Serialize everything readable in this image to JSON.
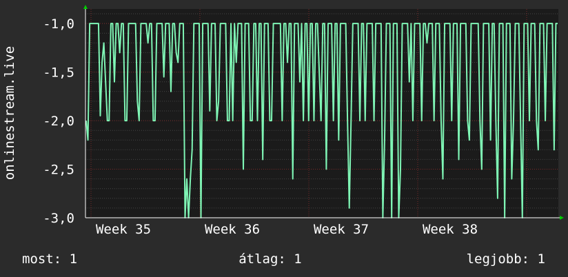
{
  "chart_data": {
    "type": "line",
    "ylabel": "onlinestream.live",
    "ylim": [
      -3.0,
      -0.85
    ],
    "y_ticks": [
      "-1,0",
      "-1,5",
      "-2,0",
      "-2,5",
      "-3,0"
    ],
    "y_tick_values": [
      -1.0,
      -1.5,
      -2.0,
      -2.5,
      -3.0
    ],
    "x_week_labels": [
      "Week 35",
      "Week 36",
      "Week 37",
      "Week 38"
    ],
    "grid": true,
    "series": [
      {
        "color": "#7ff5b5",
        "values": [
          -2.0,
          -2.2,
          -1.0,
          -1.0,
          -1.0,
          -1.0,
          -1.0,
          -1.0,
          -1.95,
          -1.4,
          -1.2,
          -1.6,
          -2.0,
          -2.0,
          -1.0,
          -1.0,
          -1.6,
          -1.0,
          -1.0,
          -1.3,
          -1.0,
          -1.0,
          -2.0,
          -2.0,
          -1.0,
          -1.0,
          -1.0,
          -1.0,
          -1.0,
          -1.8,
          -2.0,
          -1.0,
          -1.0,
          -1.0,
          -1.0,
          -1.2,
          -1.0,
          -1.0,
          -2.0,
          -2.0,
          -1.0,
          -1.0,
          -1.0,
          -1.0,
          -1.55,
          -1.0,
          -1.0,
          -1.0,
          -1.7,
          -1.0,
          -1.0,
          -1.3,
          -1.4,
          -1.0,
          -1.0,
          -1.0,
          -3.0,
          -2.6,
          -3.0,
          -2.6,
          -2.3,
          -1.0,
          -1.0,
          -1.0,
          -1.0,
          -3.0,
          -1.0,
          -1.0,
          -1.0,
          -1.0,
          -1.9,
          -1.0,
          -1.0,
          -1.0,
          -2.0,
          -1.8,
          -1.0,
          -1.0,
          -1.0,
          -1.0,
          -2.0,
          -2.0,
          -1.0,
          -2.0,
          -1.0,
          -1.4,
          -1.0,
          -1.0,
          -1.0,
          -2.5,
          -1.0,
          -1.0,
          -1.0,
          -2.0,
          -2.0,
          -1.0,
          -1.0,
          -2.0,
          -1.0,
          -1.0,
          -2.4,
          -1.0,
          -1.0,
          -1.0,
          -2.0,
          -2.0,
          -1.0,
          -1.0,
          -1.0,
          -1.0,
          -1.0,
          -2.0,
          -1.0,
          -1.0,
          -1.4,
          -1.0,
          -1.0,
          -2.6,
          -1.0,
          -1.0,
          -1.0,
          -1.6,
          -1.0,
          -2.0,
          -1.0,
          -1.0,
          -2.0,
          -1.0,
          -1.0,
          -2.0,
          -1.0,
          -1.0,
          -1.5,
          -2.0,
          -1.0,
          -1.0,
          -2.5,
          -1.0,
          -1.0,
          -1.0,
          -2.0,
          -1.0,
          -1.0,
          -2.2,
          -1.0,
          -1.0,
          -1.0,
          -1.0,
          -2.0,
          -2.9,
          -2.0,
          -1.0,
          -1.0,
          -1.0,
          -1.0,
          -2.0,
          -1.0,
          -1.0,
          -2.0,
          -1.0,
          -1.0,
          -1.0,
          -1.0,
          -2.0,
          -1.0,
          -1.0,
          -1.0,
          -1.0,
          -3.0,
          -2.2,
          -1.0,
          -1.0,
          -1.0,
          -3.0,
          -1.0,
          -1.0,
          -1.0,
          -3.0,
          -2.5,
          -1.0,
          -1.0,
          -1.0,
          -1.0,
          -1.6,
          -1.0,
          -2.0,
          -1.0,
          -1.0,
          -1.0,
          -1.0,
          -2.0,
          -1.0,
          -1.0,
          -1.2,
          -1.0,
          -1.0,
          -1.0,
          -2.0,
          -1.0,
          -1.0,
          -1.0,
          -2.0,
          -2.6,
          -1.0,
          -1.0,
          -1.0,
          -1.0,
          -2.0,
          -1.0,
          -1.0,
          -1.0,
          -2.4,
          -1.0,
          -1.0,
          -1.0,
          -1.0,
          -2.0,
          -2.2,
          -1.0,
          -1.0,
          -1.0,
          -1.0,
          -1.0,
          -2.0,
          -2.5,
          -1.0,
          -1.0,
          -1.0,
          -1.0,
          -2.2,
          -1.0,
          -1.0,
          -2.0,
          -2.8,
          -1.0,
          -1.0,
          -1.0,
          -3.0,
          -1.0,
          -1.0,
          -1.0,
          -2.6,
          -2.0,
          -1.0,
          -1.0,
          -1.0,
          -2.0,
          -3.0,
          -1.0,
          -1.0,
          -1.0,
          -2.0,
          -1.0,
          -1.0,
          -1.0,
          -2.0,
          -2.3,
          -1.0,
          -1.0,
          -1.0,
          -2.0,
          -1.0,
          -1.0,
          -1.0,
          -1.0,
          -2.3,
          -1.0,
          -1.0
        ]
      }
    ]
  },
  "footer": {
    "now": "most: 1",
    "average": "átlag: 1",
    "best": "legjobb: 1"
  }
}
